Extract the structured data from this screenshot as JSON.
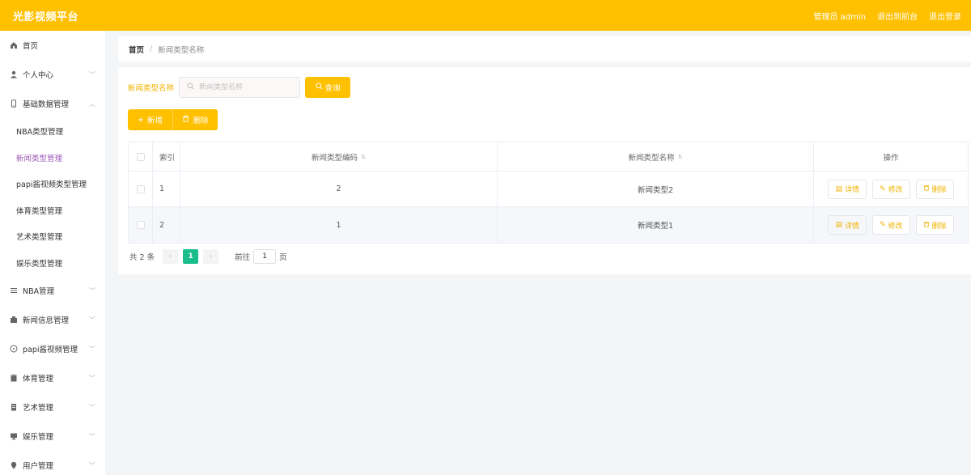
{
  "header": {
    "title": "光影视频平台",
    "role_text": "管理员 admin",
    "to_front": "退出到前台",
    "logout": "退出登录"
  },
  "sidebar": {
    "items": [
      {
        "label": "首页",
        "icon": "home-icon"
      },
      {
        "label": "个人中心",
        "icon": "user-icon"
      },
      {
        "label": "基础数据管理",
        "icon": "phone-icon"
      }
    ],
    "sub_items": [
      {
        "label": "NBA类型管理"
      },
      {
        "label": "新闻类型管理"
      },
      {
        "label": "papi酱视频类型管理"
      },
      {
        "label": "体育类型管理"
      },
      {
        "label": "艺术类型管理"
      },
      {
        "label": "娱乐类型管理"
      }
    ],
    "items_after": [
      {
        "label": "NBA管理",
        "icon": "list-icon"
      },
      {
        "label": "新闻信息管理",
        "icon": "news-icon"
      },
      {
        "label": "papi酱视频管理",
        "icon": "compass-icon"
      },
      {
        "label": "体育管理",
        "icon": "clipboard-icon"
      },
      {
        "label": "艺术管理",
        "icon": "doc-icon"
      },
      {
        "label": "娱乐管理",
        "icon": "monitor-icon"
      },
      {
        "label": "用户管理",
        "icon": "pin-icon"
      }
    ]
  },
  "breadcrumb": {
    "home": "首页",
    "sep": "/",
    "current": "新闻类型名称"
  },
  "search": {
    "label": "新闻类型名称",
    "placeholder": "新闻类型名称",
    "query_button": "查询"
  },
  "actions": {
    "add": "新增",
    "delete": "删除"
  },
  "table": {
    "headers": {
      "index": "索引",
      "code": "新闻类型编码",
      "name": "新闻类型名称",
      "ops": "操作"
    },
    "rows": [
      {
        "index": "1",
        "code": "2",
        "name": "新闻类型2"
      },
      {
        "index": "2",
        "code": "1",
        "name": "新闻类型1"
      }
    ],
    "op_labels": {
      "detail": "详情",
      "edit": "修改",
      "delete": "删除"
    }
  },
  "pager": {
    "total": "共 2 条",
    "prev": "‹",
    "current": "1",
    "next": "›",
    "goto_prefix": "前往",
    "goto_value": "1",
    "goto_suffix": "页"
  },
  "colors": {
    "accent": "#ffc000",
    "active_sub": "#9b59b6",
    "pager_current": "#19be8c"
  }
}
